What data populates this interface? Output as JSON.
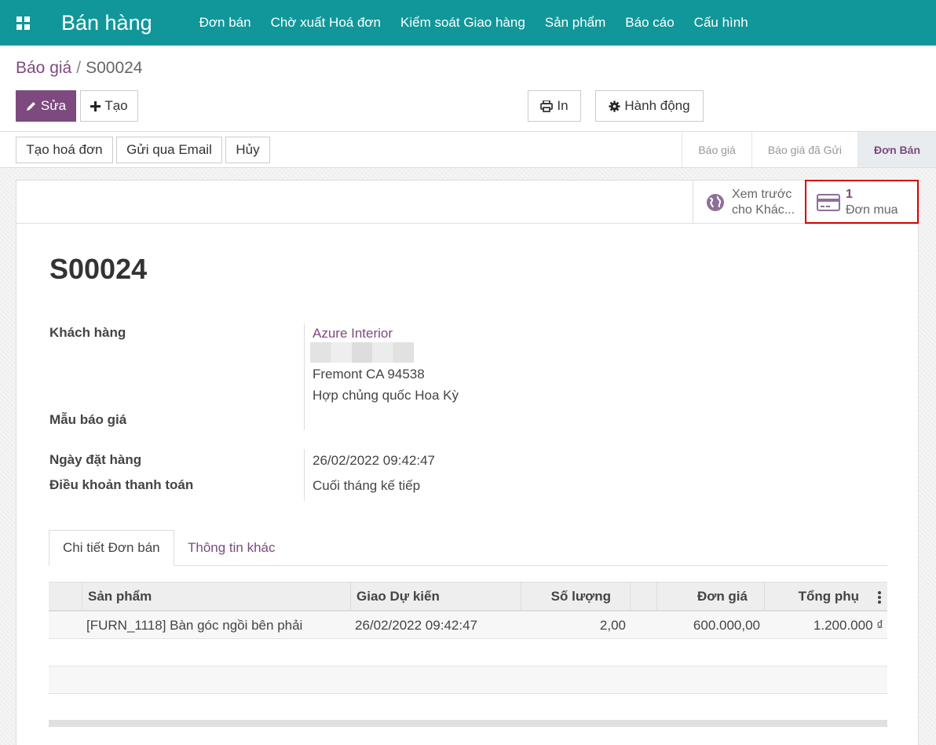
{
  "navbar": {
    "brand": "Bán hàng",
    "menu": [
      "Đơn bán",
      "Chờ xuất Hoá đơn",
      "Kiểm soát Giao hàng",
      "Sản phẩm",
      "Báo cáo",
      "Cấu hình"
    ],
    "color": "#11979a"
  },
  "breadcrumb": {
    "parent": "Báo giá",
    "separator": "/",
    "current": "S00024"
  },
  "toolbar": {
    "edit": "Sửa",
    "create": "Tạo",
    "print": "In",
    "action": "Hành động"
  },
  "statusbar": {
    "buttons": [
      "Tạo hoá đơn",
      "Gửi qua Email",
      "Hủy"
    ],
    "stages": [
      "Báo giá",
      "Báo giá đã Gửi",
      "Đơn Bán"
    ],
    "active_stage": "Đơn Bán"
  },
  "smart_buttons": {
    "preview_line1": "Xem trước",
    "preview_line2": "cho Khác...",
    "purchase_count": "1",
    "purchase_label": "Đơn mua"
  },
  "record": {
    "title": "S00024",
    "customer_label": "Khách hàng",
    "customer_name": "Azure Interior",
    "customer_city": "Fremont CA 94538",
    "customer_country": "Hợp chủng quốc Hoa Kỳ",
    "template_label": "Mẫu báo giá",
    "order_date_label": "Ngày đặt hàng",
    "order_date": "26/02/2022 09:42:47",
    "payment_terms_label": "Điều khoản thanh toán",
    "payment_terms": "Cuối tháng kế tiếp"
  },
  "tabs": [
    "Chi tiết Đơn bán",
    "Thông tin khác"
  ],
  "table": {
    "headers": [
      "Sản phẩm",
      "Giao Dự kiến",
      "Số lượng",
      "Đơn giá",
      "Tổng phụ"
    ],
    "rows": [
      {
        "product": "[FURN_1118] Bàn góc ngồi bên phải",
        "date": "26/02/2022 09:42:47",
        "qty": "2,00",
        "price": "600.000,00",
        "subtotal": "1.200.000 ₫"
      }
    ]
  },
  "accent": "#7c4a7f"
}
